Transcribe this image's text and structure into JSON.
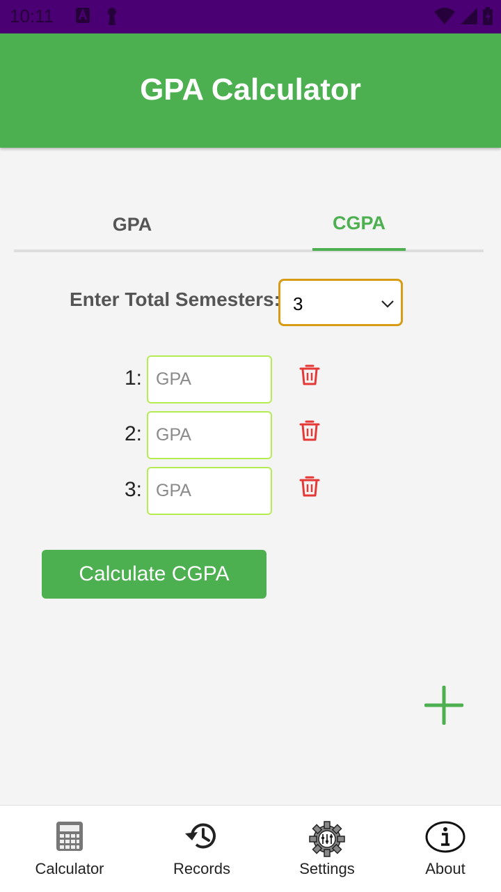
{
  "status_bar": {
    "time": "10:11"
  },
  "app_bar": {
    "title": "GPA Calculator"
  },
  "tabs": [
    {
      "label": "GPA",
      "active": false
    },
    {
      "label": "CGPA",
      "active": true
    }
  ],
  "semesters": {
    "label": "Enter Total Semesters:",
    "selected": "3"
  },
  "rows": [
    {
      "label": "1:",
      "placeholder": "GPA"
    },
    {
      "label": "2:",
      "placeholder": "GPA"
    },
    {
      "label": "3:",
      "placeholder": "GPA"
    }
  ],
  "calculate_button": "Calculate CGPA",
  "bottom_nav": [
    {
      "label": "Calculator",
      "icon": "calculator-icon"
    },
    {
      "label": "Records",
      "icon": "history-icon"
    },
    {
      "label": "Settings",
      "icon": "settings-gear-icon"
    },
    {
      "label": "About",
      "icon": "info-icon"
    }
  ],
  "colors": {
    "primary_green": "#4caf50",
    "status_bar": "#4a0072",
    "select_border": "#d89b14",
    "input_border": "#b5ec54",
    "delete_red": "#e53935"
  }
}
